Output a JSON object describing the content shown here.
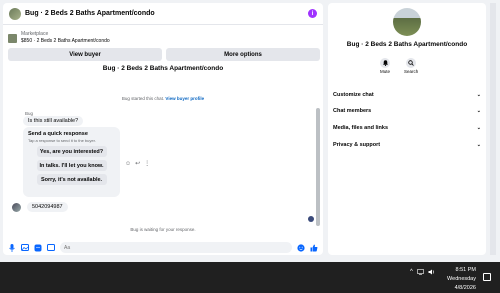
{
  "thread": {
    "title": "Bug · 2 Beds 2 Baths Apartment/condo",
    "info_icon": "i"
  },
  "listing": {
    "source": "Marketplace",
    "price_line": "$850 · 2 Beds 2 Baths Apartment/condo"
  },
  "actions": {
    "view_buyer": "View buyer",
    "more_options": "More options"
  },
  "chat": {
    "title": "Bug · 2 Beds 2 Baths Apartment/condo",
    "started_text": "Bug started this chat.",
    "view_buyer_profile": "View buyer profile",
    "sender_name": "Bug",
    "first_message": "Is this still available?",
    "quick_response_title": "Send a quick response",
    "quick_response_sub": "Tap a response to send it to the buyer.",
    "quick_responses": [
      "Yes, are you interested?",
      "In talks. I'll let you know.",
      "Sorry, it's not available."
    ],
    "phone_message": "5042094987",
    "waiting_text": "Bug is waiting for your response."
  },
  "composer": {
    "placeholder": "Aa"
  },
  "details": {
    "title": "Bug · 2 Beds 2 Baths Apartment/condo",
    "mute_label": "Mute",
    "search_label": "Search",
    "sections": [
      "Customize chat",
      "Chat members",
      "Media, files and links",
      "Privacy & support"
    ]
  },
  "taskbar": {
    "time": "8:51 PM",
    "day": "Wednesday",
    "date": "4/8/2026"
  },
  "colors": {
    "accent": "#0866ff",
    "info_purple": "#a033ff",
    "bubble": "#f0f2f5",
    "taskbar": "#202020"
  }
}
